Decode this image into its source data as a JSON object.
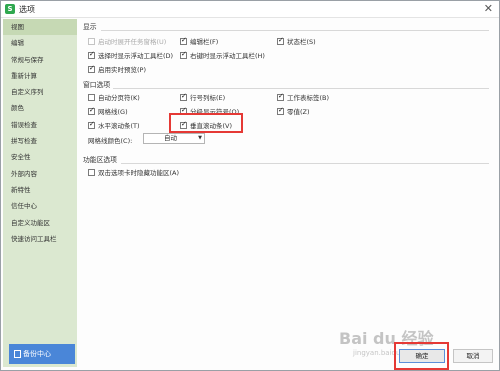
{
  "window": {
    "title": "选项"
  },
  "sidebar": {
    "items": [
      {
        "label": "视图"
      },
      {
        "label": "编辑"
      },
      {
        "label": "常规与保存"
      },
      {
        "label": "重新计算"
      },
      {
        "label": "自定义序列"
      },
      {
        "label": "颜色"
      },
      {
        "label": "错误检查"
      },
      {
        "label": "拼写检查"
      },
      {
        "label": "安全性"
      },
      {
        "label": "外部内容"
      },
      {
        "label": "新特性"
      },
      {
        "label": "信任中心"
      },
      {
        "label": "自定义功能区"
      },
      {
        "label": "快速访问工具栏"
      }
    ],
    "backup_label": "备份中心"
  },
  "display": {
    "heading": "显示",
    "options": [
      {
        "label": "启动时展开任务窗格(U)",
        "checked": false,
        "disabled": true
      },
      {
        "label": "编辑栏(F)",
        "checked": true
      },
      {
        "label": "状态栏(S)",
        "checked": true
      },
      {
        "label": "选择时显示浮动工具栏(D)",
        "checked": true
      },
      {
        "label": "右键时显示浮动工具栏(H)",
        "checked": true
      },
      {
        "label": "启用实时预览(P)",
        "checked": true
      }
    ]
  },
  "window_options": {
    "heading": "窗口选项",
    "options": [
      {
        "label": "自动分页符(K)",
        "checked": false
      },
      {
        "label": "行号列标(E)",
        "checked": true
      },
      {
        "label": "工作表标签(B)",
        "checked": true
      },
      {
        "label": "网格线(G)",
        "checked": true
      },
      {
        "label": "分级显示符号(O)",
        "checked": true
      },
      {
        "label": "零值(Z)",
        "checked": true
      },
      {
        "label": "水平滚动条(T)",
        "checked": true
      },
      {
        "label": "垂直滚动条(V)",
        "checked": true
      }
    ],
    "gridline_color_label": "网格线颜色(C):",
    "gridline_color_value": "自动"
  },
  "ribbon": {
    "heading": "功能区选项",
    "options": [
      {
        "label": "双击选项卡时隐藏功能区(A)",
        "checked": false
      }
    ]
  },
  "buttons": {
    "ok": "确定",
    "cancel": "取消"
  },
  "watermark": {
    "text": "Bai du 经验",
    "sub": "jingyan.baidu.com"
  },
  "colors": {
    "highlight": "#e53935",
    "sidebar_bg": "#dbe8d0",
    "backup_bg": "#4a86d8"
  }
}
